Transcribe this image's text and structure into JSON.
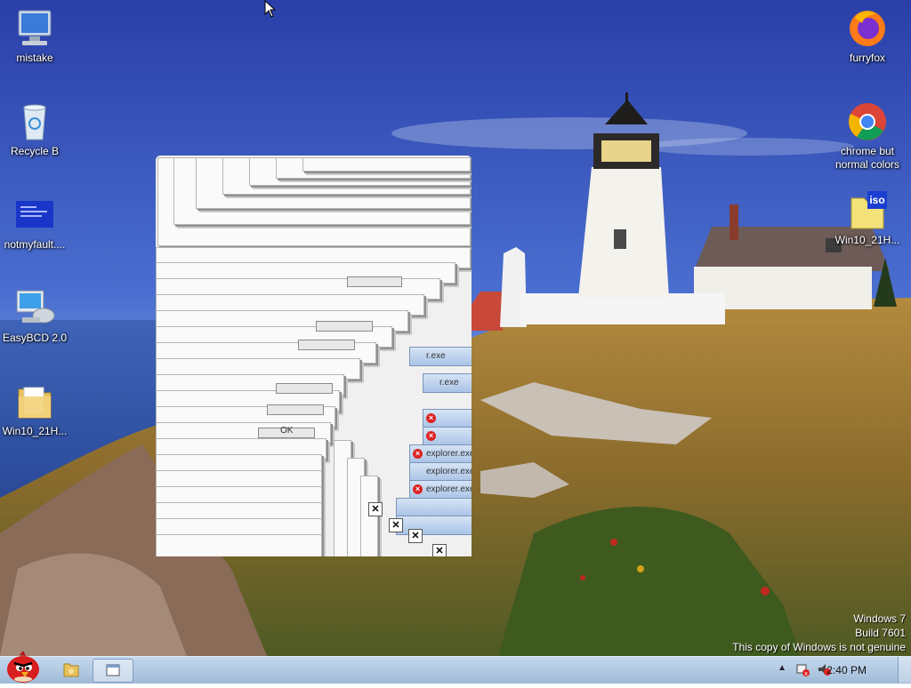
{
  "desktop": {
    "icons_left": [
      {
        "label": "mistake",
        "icon": "computer-icon"
      },
      {
        "label": "Recycle B",
        "icon": "recycle-bin-icon"
      },
      {
        "label": "notmyfault....",
        "icon": "bsod-file-icon"
      },
      {
        "label": "EasyBCD 2.0",
        "icon": "easybcd-icon"
      },
      {
        "label": "Win10_21H...",
        "icon": "folder-icon"
      }
    ],
    "icons_right": [
      {
        "label": "furryfox",
        "icon": "firefox-icon"
      },
      {
        "label": "chrome but normal colors",
        "icon": "chrome-icon"
      },
      {
        "label": "Win10_21H...",
        "icon": "iso-file-icon"
      }
    ]
  },
  "glitch_window": {
    "ok_label": "OK",
    "title_fragment": "explorer.exe",
    "exe_fragment": "r.exe",
    "close_glyph": "✕"
  },
  "watermark": {
    "line1": "Windows 7",
    "line2": "Build 7601",
    "line3": "This copy of Windows is not genuine"
  },
  "taskbar": {
    "clock": "2:40 PM"
  }
}
